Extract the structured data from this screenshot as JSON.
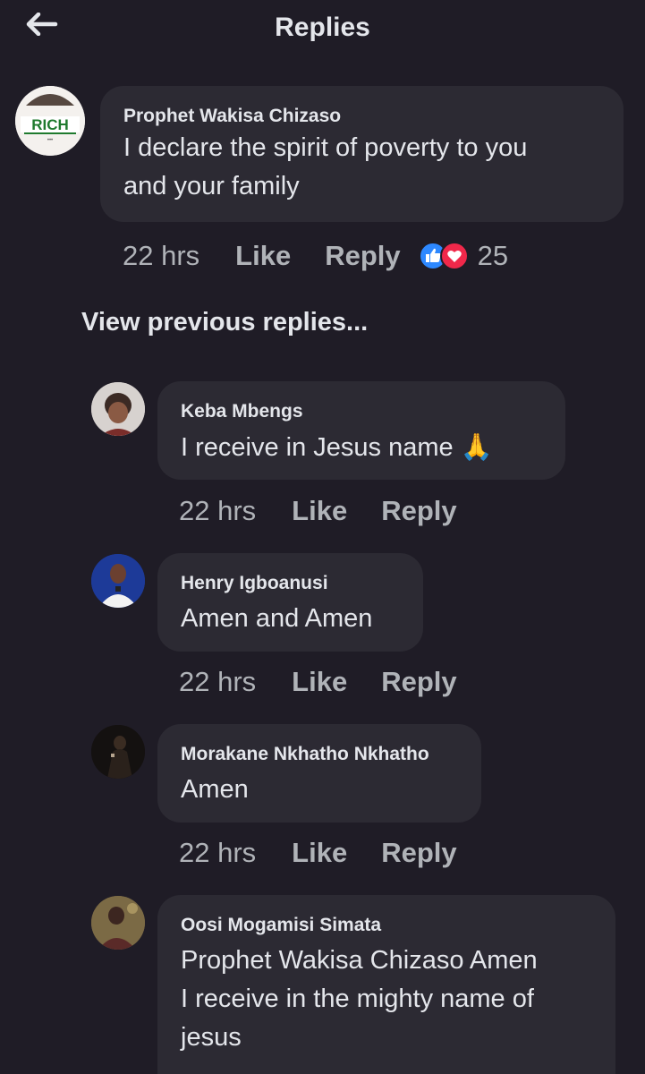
{
  "header": {
    "title": "Replies",
    "back_icon": "arrow-left-icon"
  },
  "main_comment": {
    "author": "Prophet Wakisa Chizaso",
    "text_line1": "I declare the spirit of poverty to  you",
    "text_line2": "and your family",
    "time": "22 hrs",
    "like_label": "Like",
    "reply_label": "Reply",
    "reaction_count": "25",
    "reactions": [
      "like-reaction-icon",
      "love-reaction-icon"
    ],
    "avatar_logo_text": "RICH"
  },
  "view_previous_label": "View previous replies...",
  "replies": [
    {
      "author": "Keba Mbengs",
      "text": "I receive in Jesus name",
      "emoji": "🙏",
      "time": "22 hrs",
      "like_label": "Like",
      "reply_label": "Reply"
    },
    {
      "author": "Henry Igboanusi",
      "text": "Amen and Amen",
      "time": "22 hrs",
      "like_label": "Like",
      "reply_label": "Reply"
    },
    {
      "author": "Morakane Nkhatho Nkhatho",
      "text": "Amen",
      "time": "22 hrs",
      "like_label": "Like",
      "reply_label": "Reply"
    },
    {
      "author": "Oosi Mogamisi Simata",
      "text_line1": "Prophet Wakisa Chizaso Amen",
      "text_line2": "I receive in the mighty name of",
      "text_line3": "jesus"
    }
  ],
  "colors": {
    "background": "#1f1c26",
    "bubble": "#2c2a33",
    "text_primary": "#e4e6eb",
    "text_secondary": "#b0b3b8",
    "like_blue": "#2d88ff",
    "love_red": "#f0284a"
  }
}
